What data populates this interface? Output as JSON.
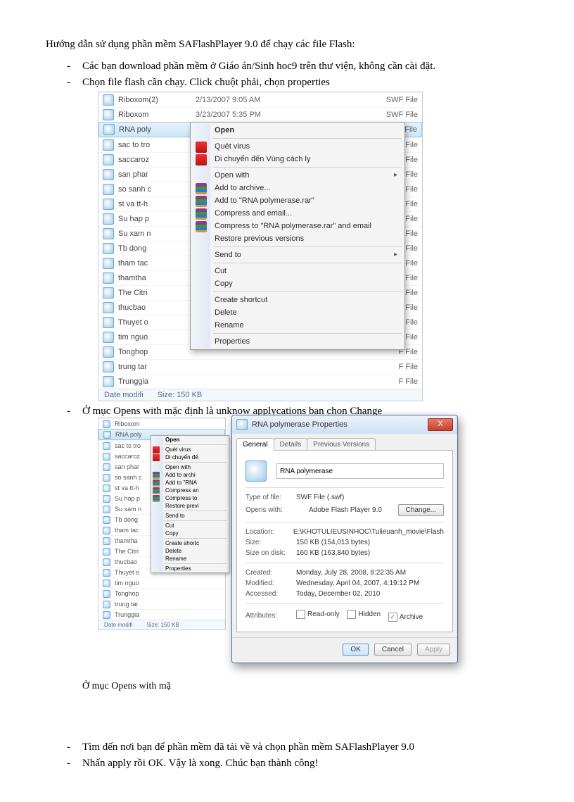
{
  "title": "Hướng dẫn sử dụng phần mềm SAFlashPlayer 9.0 để chạy các file Flash:",
  "bullets": {
    "b1": "Các bạn download phần mềm ở Giáo án/Sinh hoc9 trên thư viện, không cần cài đặt.",
    "b2": "Chọn file flash cần chạy. Click chuột phải, chọn properties",
    "b3": "Ở mục Opens with mặc định là unknow applycations bạn chọn Change",
    "b4": "Tìm đến nơi bạn để phần mềm đã tải về và chọn phần mềm SAFlashPlayer 9.0",
    "b5": "Nhấn apply rồi OK. Vậy là xong. Chúc bạn thành công!"
  },
  "files": [
    {
      "name": "Riboxom(2)",
      "date": "2/13/2007 9:05 AM",
      "type": "SWF File"
    },
    {
      "name": "Riboxom",
      "date": "3/23/2007 5:35 PM",
      "type": "SWF File"
    },
    {
      "name": "RNA poly",
      "date": "",
      "type": "F File"
    },
    {
      "name": "sac to tro",
      "date": "",
      "type": "F File"
    },
    {
      "name": "saccaroz",
      "date": "",
      "type": "F File"
    },
    {
      "name": "san phar",
      "date": "",
      "type": "F File"
    },
    {
      "name": "so sanh c",
      "date": "",
      "type": "F File"
    },
    {
      "name": "st va tt-h",
      "date": "",
      "type": "F File"
    },
    {
      "name": "Su hap p",
      "date": "",
      "type": "F File"
    },
    {
      "name": "Su xam n",
      "date": "",
      "type": "F File"
    },
    {
      "name": "Tb dong",
      "date": "",
      "type": "F File"
    },
    {
      "name": "tham tac",
      "date": "",
      "type": "F File"
    },
    {
      "name": "thamtha",
      "date": "",
      "type": "F File"
    },
    {
      "name": "The Citri",
      "date": "",
      "type": "F File"
    },
    {
      "name": "thucbao",
      "date": "",
      "type": "F File"
    },
    {
      "name": "Thuyet o",
      "date": "",
      "type": "F File"
    },
    {
      "name": "tim nguo",
      "date": "",
      "type": "F File"
    },
    {
      "name": "Tonghop",
      "date": "",
      "type": "F File"
    },
    {
      "name": "trung tar",
      "date": "",
      "type": "F File"
    },
    {
      "name": "Trunggia",
      "date": "",
      "type": "F File"
    }
  ],
  "status": {
    "label": "Date modifi",
    "size_label": "Size:",
    "size": "150 KB"
  },
  "context_menu": {
    "open": "Open",
    "quet": "Quét virus",
    "dichuyen": "Di chuyển đến Vùng cách ly",
    "openwith": "Open with",
    "addarchive": "Add to archive...",
    "addrar": "Add to \"RNA polymerase.rar\"",
    "compemail": "Compress and email...",
    "compraremail": "Compress to \"RNA polymerase.rar\" and email",
    "restore": "Restore previous versions",
    "sendto": "Send to",
    "cut": "Cut",
    "copy": "Copy",
    "shortcut": "Create shortcut",
    "delete": "Delete",
    "rename": "Rename",
    "properties": "Properties"
  },
  "files2": [
    "Riboxom",
    "RNA poly",
    "sac to tro",
    "saccaroz",
    "san phar",
    "so sanh c",
    "st va tt-h",
    "Su hap p",
    "Su xam n",
    "Tb dong",
    "tham tac",
    "thamtha",
    "The Citri",
    "thucbao",
    "Thuyet o",
    "tim nguo",
    "Tonghop",
    "trung tar",
    "Trunggia"
  ],
  "ctx2": {
    "open": "Open",
    "quet": "Quét virus",
    "dichuyen": "Di chuyển đế",
    "openwith": "Open with",
    "addarchive": "Add to archi",
    "addrar": "Add to \"RNA",
    "compemail": "Compress an",
    "compraremail": "Compress to",
    "restore": "Restore previ",
    "sendto": "Send to",
    "cut": "Cut",
    "copy": "Copy",
    "shortcut": "Create shortc",
    "delete": "Delete",
    "rename": "Rename",
    "properties": "Properties"
  },
  "status2": {
    "label": "Date modifi",
    "size_label": "Size:",
    "size": "150 KB"
  },
  "caption_under": "Ở mục Opens with mặ",
  "props": {
    "title": "RNA polymerase Properties",
    "close": "X",
    "tabs": {
      "general": "General",
      "details": "Details",
      "prev": "Previous Versions"
    },
    "name": "RNA polymerase",
    "labels": {
      "typeoffile": "Type of file:",
      "openswith": "Opens with:",
      "change": "Change...",
      "location": "Location:",
      "size": "Size:",
      "sizeondisk": "Size on disk:",
      "created": "Created:",
      "modified": "Modified:",
      "accessed": "Accessed:",
      "attributes": "Attributes:",
      "readonly": "Read-only",
      "hidden": "Hidden",
      "archive": "Archive"
    },
    "values": {
      "typeoffile": "SWF File (.swf)",
      "openswith": "Adobe Flash Player 9.0",
      "location": "E:\\KHOTULIEUSINHOC\\Tulieuanh_movie\\Flash",
      "size": "150 KB (154,013 bytes)",
      "sizeondisk": "160 KB (163,840 bytes)",
      "created": "Monday, July 28, 2008, 8:22:35 AM",
      "modified": "Wednesday, April 04, 2007, 4:19:12 PM",
      "accessed": "Today, December 02, 2010"
    },
    "buttons": {
      "ok": "OK",
      "cancel": "Cancel",
      "apply": "Apply"
    }
  }
}
